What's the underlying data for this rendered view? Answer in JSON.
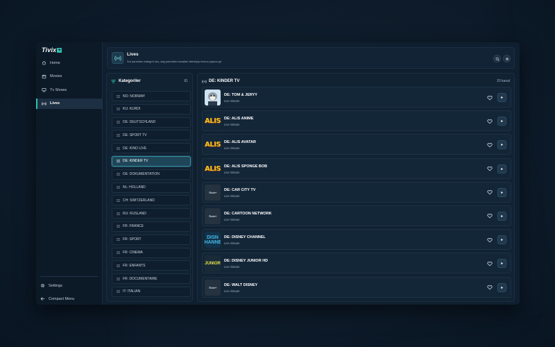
{
  "app": {
    "logo_text": "Tivix",
    "logo_plus": "+"
  },
  "sidebar": {
    "items": [
      {
        "label": "Home",
        "icon": "home-icon",
        "active": false
      },
      {
        "label": "Movies",
        "icon": "film-icon",
        "active": false
      },
      {
        "label": "Tv Shows",
        "icon": "tv-icon",
        "active": false
      },
      {
        "label": "Lives",
        "icon": "broadcast-icon",
        "active": true
      }
    ],
    "settings_label": "Settings",
    "compact_label": "Compact Menu"
  },
  "header": {
    "title": "Lives",
    "subtitle": "Sol panelden kategori seç, sağ panelden kanalları listeleyip hızlıca yayına gir."
  },
  "categories": {
    "title": "Kategoriler",
    "count": "81",
    "items": [
      {
        "label": "NO: NORWAY",
        "active": false
      },
      {
        "label": "KU: KURDI",
        "active": false
      },
      {
        "label": "DE: DEUTSCHLAND",
        "active": false
      },
      {
        "label": "DE: SPORT TV",
        "active": false
      },
      {
        "label": "DE: KINO LIVE",
        "active": false
      },
      {
        "label": "DE: KINDER TV",
        "active": true
      },
      {
        "label": "DE: DOKUMENTATION",
        "active": false
      },
      {
        "label": "NL: HOLLAND",
        "active": false
      },
      {
        "label": "CH: SWITZERLAND",
        "active": false
      },
      {
        "label": "RU: RUSLAND",
        "active": false
      },
      {
        "label": "FR: FRANCE",
        "active": false
      },
      {
        "label": "FR: SPORT",
        "active": false
      },
      {
        "label": "FR: CINEMA",
        "active": false
      },
      {
        "label": "FR: ENFANTS",
        "active": false
      },
      {
        "label": "FR: DOCUMENTAIRE",
        "active": false
      },
      {
        "label": "IT: ITALIAN",
        "active": false
      }
    ]
  },
  "channels": {
    "title": "DE: KINDER TV",
    "count": "20 kanal",
    "items": [
      {
        "name": "DE: TOM & JERYY",
        "sub": "Live Stream",
        "logo": "tj"
      },
      {
        "name": "DE: ALIS ANIME",
        "sub": "Live Stream",
        "logo": "alis",
        "logo_text": "ALIS"
      },
      {
        "name": "DE: ALIS AVATAR",
        "sub": "Live Stream",
        "logo": "alis",
        "logo_text": "ALIS"
      },
      {
        "name": "DE: ALIS SPONGE BOB",
        "sub": "Live Stream",
        "logo": "alis",
        "logo_text": "ALIS"
      },
      {
        "name": "DE: CAR CITY TV",
        "sub": "Live Stream",
        "logo": "tivix",
        "logo_text": "Tivix+"
      },
      {
        "name": "DE: CARTOON NETWORK",
        "sub": "Live Stream",
        "logo": "tivix",
        "logo_text": "Tivix+"
      },
      {
        "name": "DE: DISNEY CHANNEL",
        "sub": "Live Stream",
        "logo": "disney",
        "logo_text": "DISN CHANNEL"
      },
      {
        "name": "DE: DISNEY JUNIOR HD",
        "sub": "Live Stream",
        "logo": "junior",
        "logo_text": "JUNIOR"
      },
      {
        "name": "DE: WALT DISNEY",
        "sub": "Live Stream",
        "logo": "tivix",
        "logo_text": "Tivix+"
      }
    ]
  },
  "colors": {
    "accent": "#2cc2b0",
    "background": "#0d1b2a",
    "panel": "#112233",
    "active_category": "#1f4558"
  }
}
